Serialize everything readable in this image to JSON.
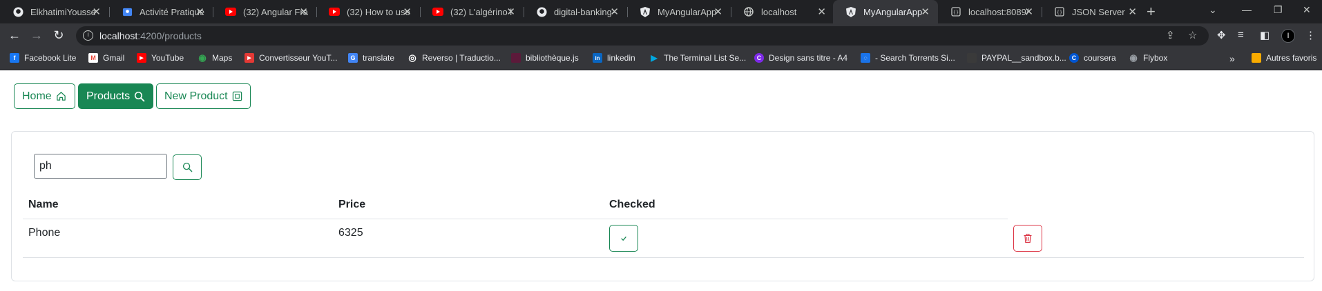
{
  "browser": {
    "tabs": [
      {
        "title": "ElkhatimiYoussef",
        "icon": "github-icon"
      },
      {
        "title": "Activité Pratique",
        "icon": "classroom-icon"
      },
      {
        "title": "(32) Angular Fra",
        "icon": "youtube-icon"
      },
      {
        "title": "(32) How to use",
        "icon": "youtube-icon"
      },
      {
        "title": "(32) L'algérino l",
        "icon": "youtube-icon"
      },
      {
        "title": "digital-banking-",
        "icon": "github-icon"
      },
      {
        "title": "MyAngularApp",
        "icon": "angular-icon"
      },
      {
        "title": "localhost",
        "icon": "globe-icon"
      },
      {
        "title": "MyAngularApp",
        "icon": "angular-icon"
      },
      {
        "title": "localhost:8089/",
        "icon": "server-icon"
      },
      {
        "title": "JSON Server",
        "icon": "server-icon"
      }
    ],
    "active_tab_index": 8,
    "url_host": "localhost",
    "url_path": ":4200/products",
    "bookmarks": [
      {
        "label": "Facebook Lite",
        "color": "#1877f2",
        "glyph": "f"
      },
      {
        "label": "Gmail",
        "color": "#ea4335",
        "glyph": "M"
      },
      {
        "label": "YouTube",
        "color": "#ff0000",
        "glyph": "▶"
      },
      {
        "label": "Maps",
        "color": "#34a853",
        "glyph": "◉"
      },
      {
        "label": "Convertisseur YouT...",
        "color": "#e53935",
        "glyph": "▶"
      },
      {
        "label": "translate",
        "color": "#4285f4",
        "glyph": "G"
      },
      {
        "label": "Reverso | Traductio...",
        "color": "#ffffff",
        "glyph": "◎"
      },
      {
        "label": "bibliothèque.js",
        "color": "#5c1a3a",
        "glyph": "▪"
      },
      {
        "label": "linkedin",
        "color": "#0a66c2",
        "glyph": "in"
      },
      {
        "label": "The Terminal List Se...",
        "color": "#00a8e1",
        "glyph": "▶"
      },
      {
        "label": "Design sans titre - A4",
        "color": "#7d2ae8",
        "glyph": "C"
      },
      {
        "label": "- Search Torrents Si...",
        "color": "#1a73e8",
        "glyph": "◌"
      },
      {
        "label": "PAYPAL__sandbox.b...",
        "color": "#3a3a3a",
        "glyph": "▪"
      },
      {
        "label": "coursera",
        "color": "#0056d2",
        "glyph": "C"
      },
      {
        "label": "Flybox",
        "color": "#9aa0a6",
        "glyph": "◉"
      }
    ],
    "other_bookmarks": "Autres favoris",
    "profile_initial": "I"
  },
  "nav": {
    "home_label": "Home",
    "products_label": "Products",
    "new_product_label": "New Product"
  },
  "search": {
    "value": "ph"
  },
  "table": {
    "headers": [
      "Name",
      "Price",
      "Checked"
    ],
    "rows": [
      {
        "name": "Phone",
        "price": "6325"
      }
    ]
  },
  "colors": {
    "primary": "#198754",
    "danger": "#dc3545",
    "chrome_dark": "#202124",
    "chrome_mid": "#35363a"
  }
}
